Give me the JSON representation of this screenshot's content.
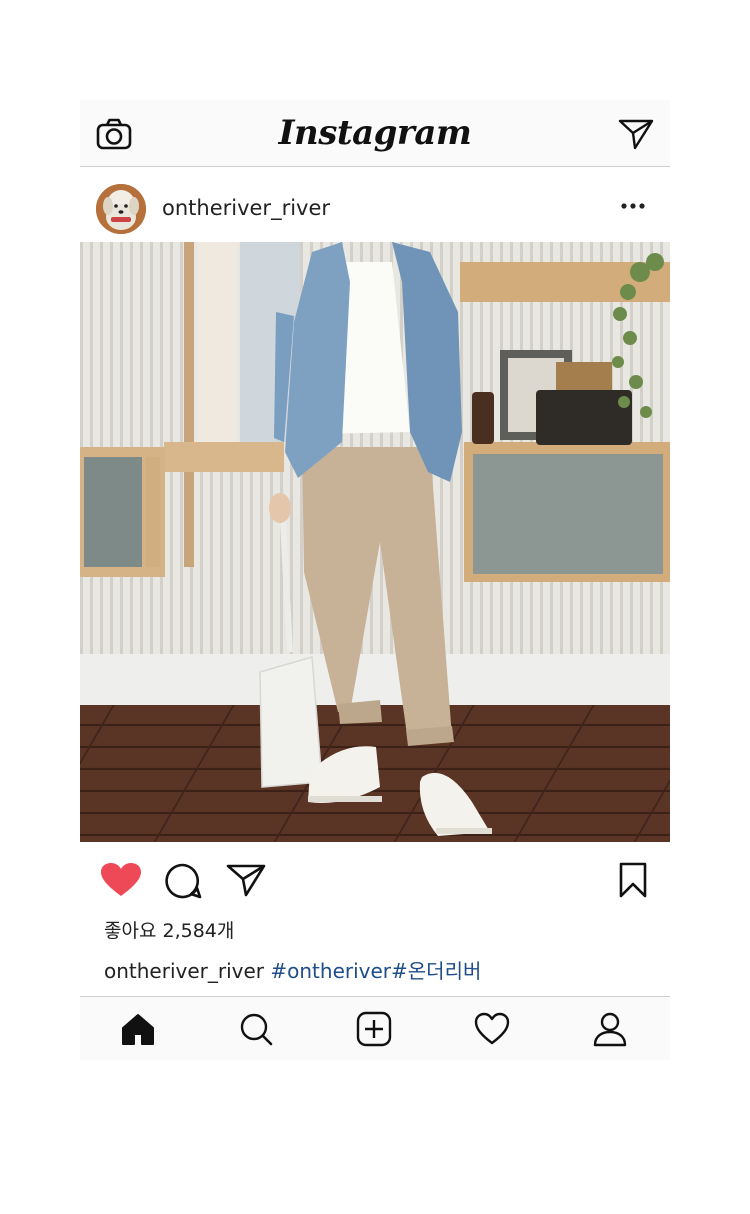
{
  "header": {
    "logo_text": "Instagram",
    "camera_icon": "camera-icon",
    "direct_icon": "paper-plane-icon"
  },
  "post": {
    "username": "ontheriver_river",
    "more_icon": "more-dots-icon",
    "likes_text": "좋아요 2,584개",
    "caption_user": "ontheriver_river",
    "caption_tags": "#ontheriver#온더리버",
    "liked": true
  },
  "actions": {
    "like_icon": "heart-filled-icon",
    "comment_icon": "comment-bubble-icon",
    "share_icon": "paper-plane-icon",
    "save_icon": "bookmark-icon"
  },
  "bottom_nav": {
    "items": [
      "home-icon",
      "search-icon",
      "add-post-icon",
      "activity-heart-icon",
      "profile-icon"
    ]
  },
  "colors": {
    "like": "#ed4956",
    "hashtag": "#1e4d8a",
    "bar_bg": "#fafafa"
  }
}
